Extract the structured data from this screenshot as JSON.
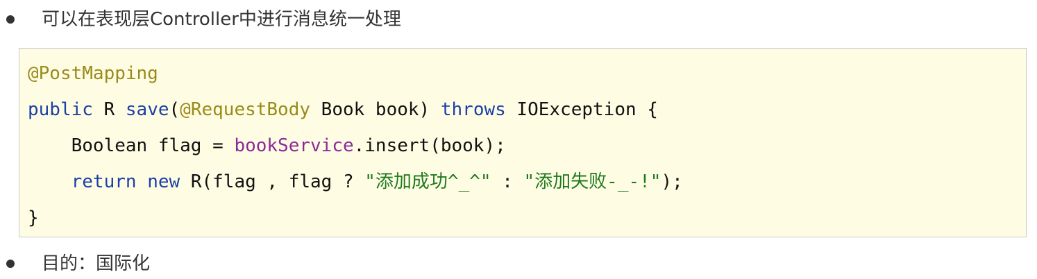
{
  "bullets": {
    "first": "可以在表现层Controller中进行消息统一处理",
    "second": "目的：国际化"
  },
  "code": {
    "line1": {
      "annotation": "@PostMapping"
    },
    "line2": {
      "kw_public": "public",
      "t1": " R ",
      "method": "save",
      "t2": "(",
      "annotation": "@RequestBody",
      "t3": " Book book) ",
      "kw_throws": "throws",
      "t4": " IOException {"
    },
    "line3": {
      "indent": "    ",
      "t1": "Boolean flag = ",
      "field": "bookService",
      "t2": ".insert(book);"
    },
    "line4": {
      "indent": "    ",
      "kw_return": "return",
      "sp": " ",
      "kw_new": "new",
      "t1": " R(flag , flag ? ",
      "str1": "\"添加成功^_^\"",
      "t2": " : ",
      "str2": "\"添加失败-_-!\"",
      "t3": ");"
    },
    "line5": {
      "t1": "}"
    }
  },
  "colors": {
    "annotation": "#9a8a1c",
    "keyword": "#1c3fa8",
    "field": "#8a2a9a",
    "string": "#1f7a1f",
    "code_background": "#fefde3"
  }
}
